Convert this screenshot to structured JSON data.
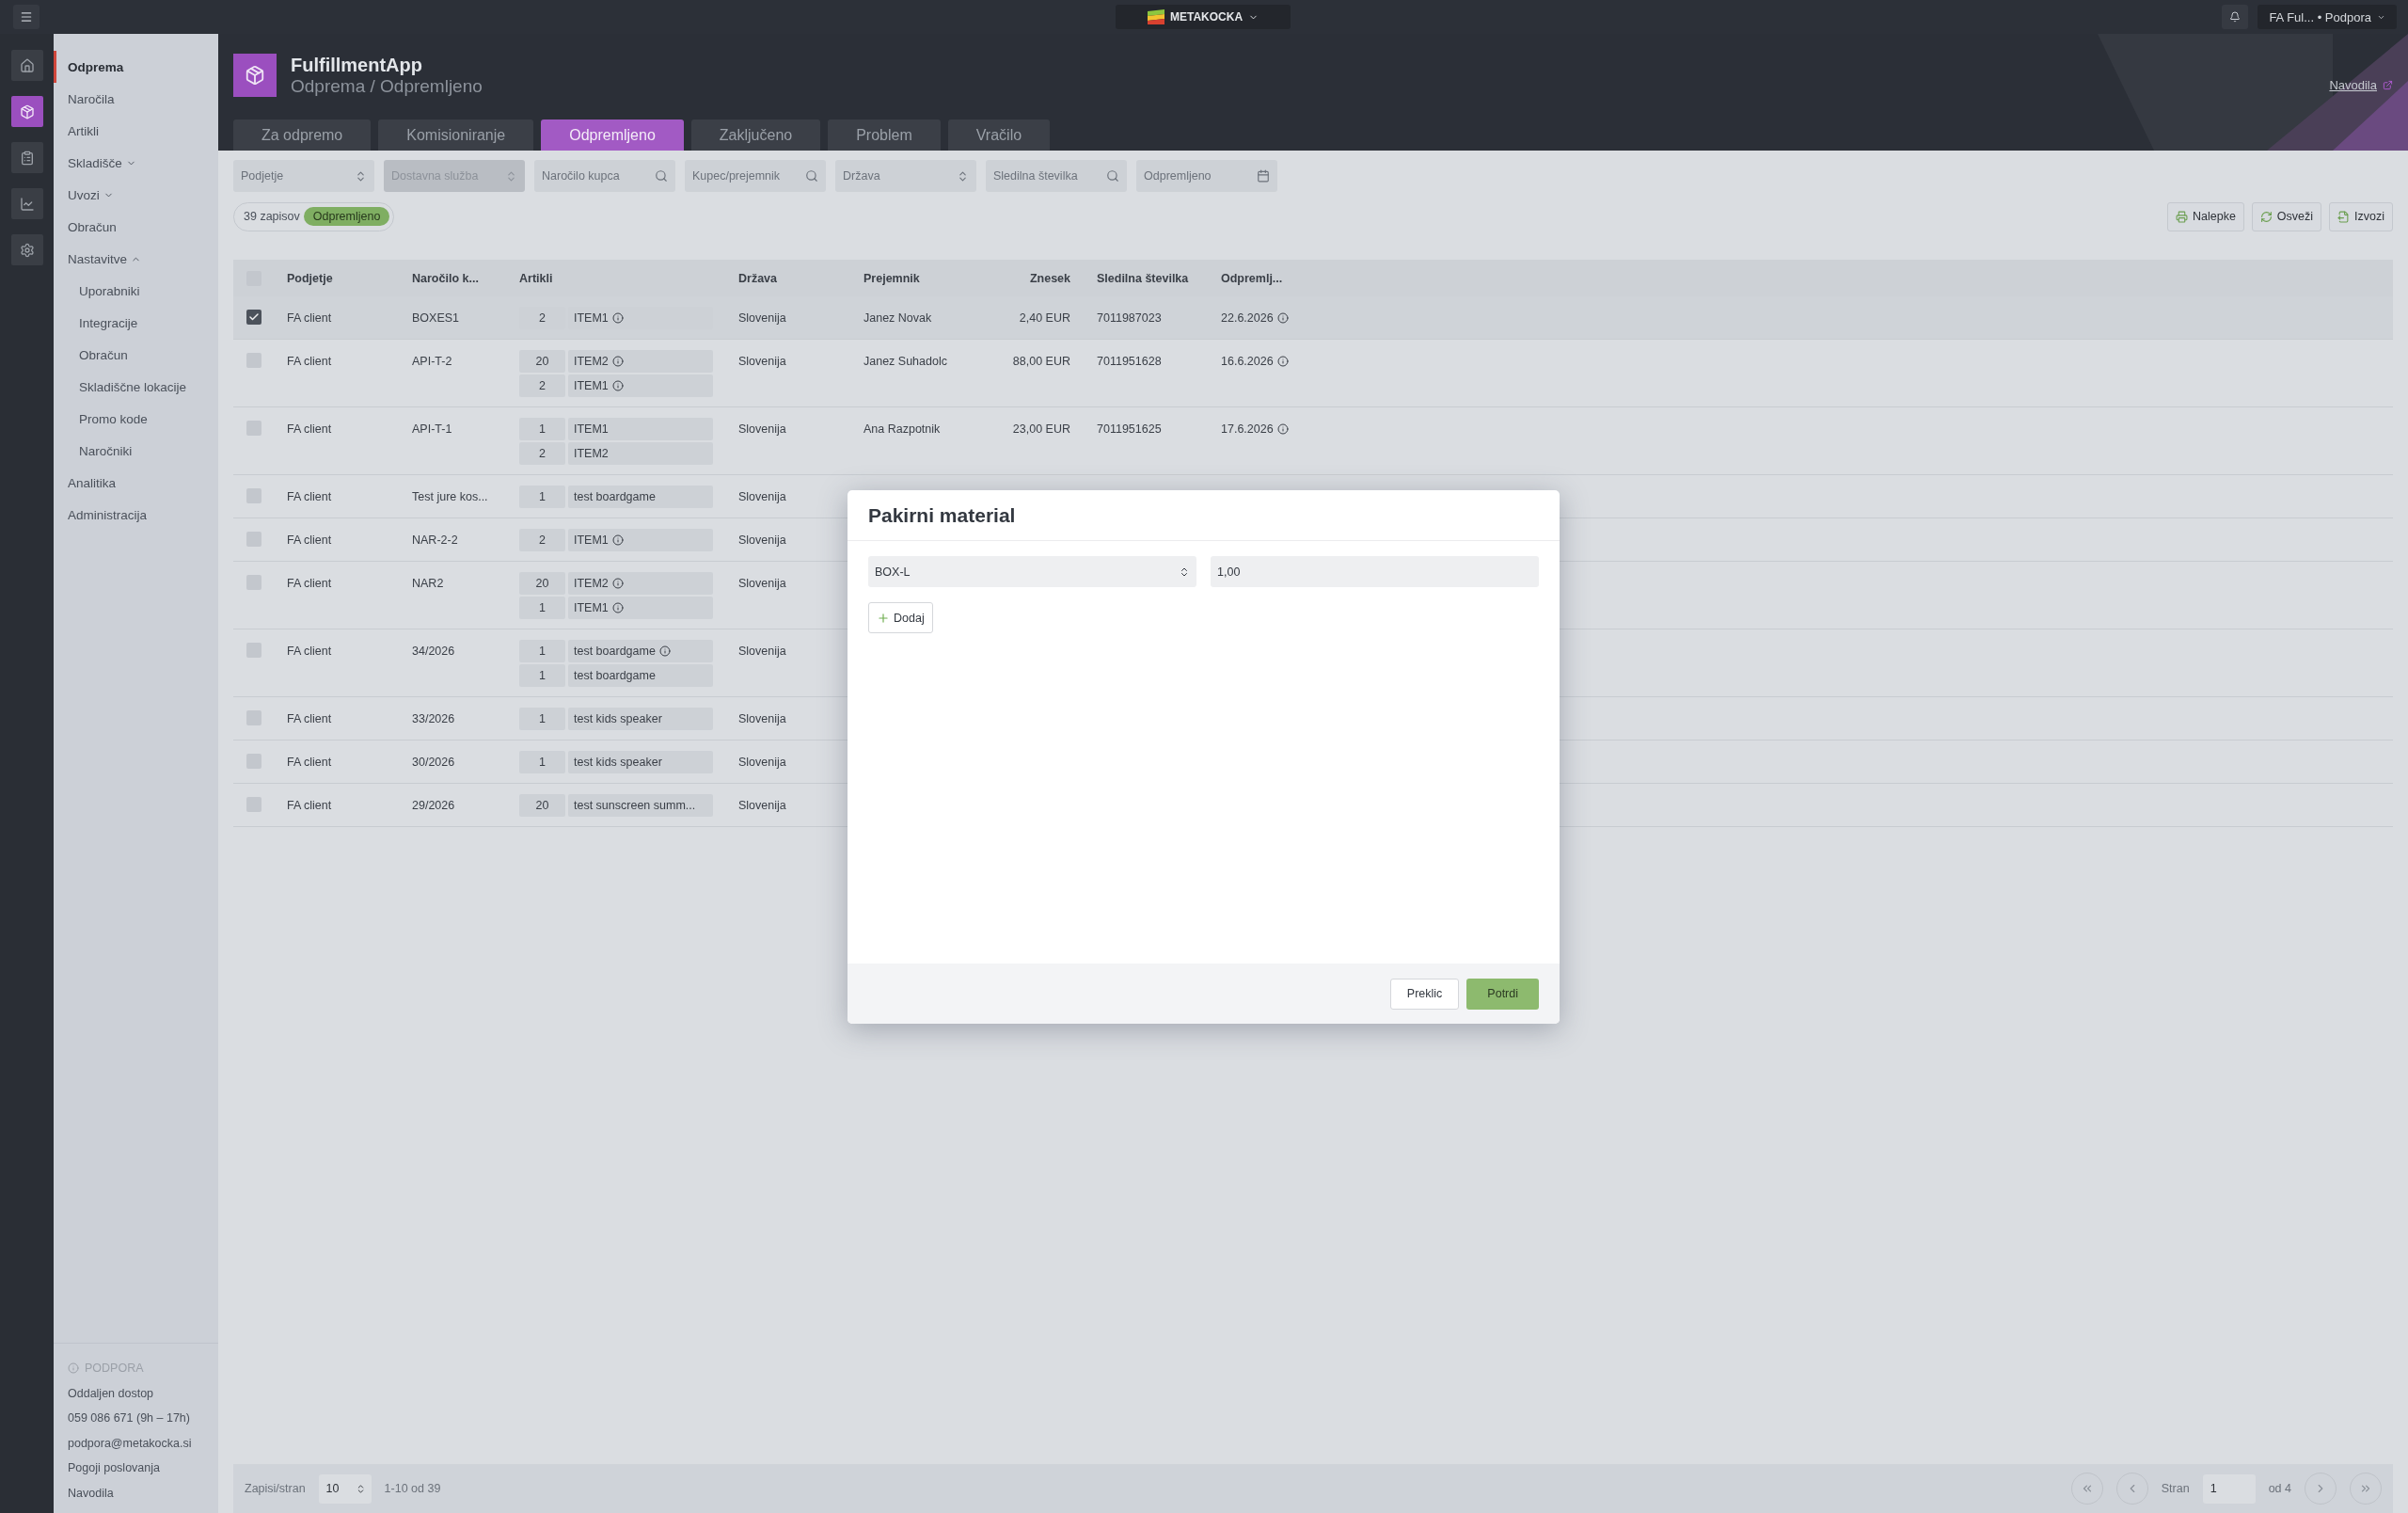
{
  "top_bar": {
    "brand": "METAKOCKA",
    "account": "FA Ful... • Podpora"
  },
  "rail": [
    {
      "kind": "home",
      "selected": false
    },
    {
      "kind": "package",
      "selected": true
    },
    {
      "kind": "report",
      "selected": false
    },
    {
      "kind": "chart",
      "selected": false
    },
    {
      "kind": "settings",
      "selected": false
    }
  ],
  "sidebar": {
    "items": [
      {
        "label": "Odprema",
        "selected": true
      },
      {
        "label": "Naročila",
        "selected": false
      },
      {
        "label": "Artikli",
        "selected": false
      },
      {
        "label": "Skladišče",
        "selected": false,
        "expanded": false
      },
      {
        "label": "Uvozi",
        "selected": false,
        "expanded": false
      },
      {
        "label": "Obračun",
        "selected": false
      },
      {
        "label": "Nastavitve",
        "selected": false,
        "expanded": true,
        "children": [
          {
            "label": "Uporabniki",
            "selected": false
          },
          {
            "label": "Integracije",
            "selected": false
          },
          {
            "label": "Obračun",
            "selected": false
          },
          {
            "label": "Skladiščne lokacije",
            "selected": false
          },
          {
            "label": "Promo kode",
            "selected": false
          },
          {
            "label": "Naročniki",
            "selected": false
          }
        ]
      },
      {
        "label": "Analitika",
        "selected": false
      },
      {
        "label": "Administracija",
        "selected": false
      }
    ],
    "support": {
      "title": "PODPORA",
      "links": [
        "Oddaljen dostop",
        "059 086 671 (9h – 17h)",
        "podpora@metakocka.si",
        "Pogoji poslovanja",
        "Navodila"
      ]
    }
  },
  "header": {
    "app": "FulfillmentApp",
    "breadcrumb": "Odprema / Odpremljeno",
    "help_link": "Navodila"
  },
  "tabs": [
    {
      "label": "Za odpremo",
      "selected": false
    },
    {
      "label": "Komisioniranje",
      "selected": false
    },
    {
      "label": "Odpremljeno",
      "selected": true
    },
    {
      "label": "Zaključeno",
      "selected": false
    },
    {
      "label": "Problem",
      "selected": false
    },
    {
      "label": "Vračilo",
      "selected": false
    }
  ],
  "filters": [
    {
      "kind": "select",
      "placeholder": "Podjetje",
      "disabled": false
    },
    {
      "kind": "select",
      "placeholder": "Dostavna služba",
      "disabled": true
    },
    {
      "kind": "search",
      "placeholder": "Naročilo kupca",
      "disabled": false
    },
    {
      "kind": "search",
      "placeholder": "Kupec/prejemnik",
      "disabled": false
    },
    {
      "kind": "select",
      "placeholder": "Država",
      "disabled": false
    },
    {
      "kind": "search",
      "placeholder": "Sledilna številka",
      "disabled": false
    },
    {
      "kind": "date",
      "placeholder": "Odpremljeno",
      "disabled": false
    }
  ],
  "summary": {
    "count": "39 zapisov",
    "status": "Odpremljeno"
  },
  "actions": [
    {
      "kind": "print",
      "label": "Nalepke"
    },
    {
      "kind": "refresh",
      "label": "Osveži"
    },
    {
      "kind": "export",
      "label": "Izvozi"
    }
  ],
  "table": {
    "all_selected": false,
    "columns": [
      "Podjetje",
      "Naročilo k...",
      "Artikli",
      "Država",
      "Prejemnik",
      "Znesek",
      "Sledilna številka",
      "Odpremlj..."
    ],
    "rows": [
      {
        "selected": true,
        "company": "FA client",
        "order": "BOXES1",
        "items": [
          {
            "qty": "2",
            "name": "ITEM1",
            "info": true
          }
        ],
        "country": "Slovenija",
        "recipient": "Janez Novak",
        "amount": "2,40 EUR",
        "tracking": "7011987023",
        "shipped": "22.6.2026",
        "shipped_info": true
      },
      {
        "selected": false,
        "company": "FA client",
        "order": "API-T-2",
        "items": [
          {
            "qty": "20",
            "name": "ITEM2",
            "info": true
          },
          {
            "qty": "2",
            "name": "ITEM1",
            "info": true
          }
        ],
        "country": "Slovenija",
        "recipient": "Janez Suhadolc",
        "amount": "88,00 EUR",
        "tracking": "7011951628",
        "shipped": "16.6.2026",
        "shipped_info": true
      },
      {
        "selected": false,
        "company": "FA client",
        "order": "API-T-1",
        "items": [
          {
            "qty": "1",
            "name": "ITEM1",
            "info": false
          },
          {
            "qty": "2",
            "name": "ITEM2",
            "info": false
          }
        ],
        "country": "Slovenija",
        "recipient": "Ana Razpotnik",
        "amount": "23,00 EUR",
        "tracking": "7011951625",
        "shipped": "17.6.2026",
        "shipped_info": true
      },
      {
        "selected": false,
        "company": "FA client",
        "order": "Test jure kos...",
        "items": [
          {
            "qty": "1",
            "name": "test boardgame",
            "info": false
          }
        ],
        "country": "Slovenija"
      },
      {
        "selected": false,
        "company": "FA client",
        "order": "NAR-2-2",
        "items": [
          {
            "qty": "2",
            "name": "ITEM1",
            "info": true
          }
        ],
        "country": "Slovenija"
      },
      {
        "selected": false,
        "company": "FA client",
        "order": "NAR2",
        "items": [
          {
            "qty": "20",
            "name": "ITEM2",
            "info": true
          },
          {
            "qty": "1",
            "name": "ITEM1",
            "info": true
          }
        ],
        "country": "Slovenija"
      },
      {
        "selected": false,
        "company": "FA client",
        "order": "34/2026",
        "items": [
          {
            "qty": "1",
            "name": "test boardgame",
            "info": true
          },
          {
            "qty": "1",
            "name": "test boardgame",
            "info": false
          }
        ],
        "country": "Slovenija"
      },
      {
        "selected": false,
        "company": "FA client",
        "order": "33/2026",
        "items": [
          {
            "qty": "1",
            "name": "test kids speaker",
            "info": false
          }
        ],
        "country": "Slovenija"
      },
      {
        "selected": false,
        "company": "FA client",
        "order": "30/2026",
        "items": [
          {
            "qty": "1",
            "name": "test kids speaker",
            "info": false
          }
        ],
        "country": "Slovenija"
      },
      {
        "selected": false,
        "company": "FA client",
        "order": "29/2026",
        "items": [
          {
            "qty": "20",
            "name": "test sunscreen summ...",
            "info": false
          }
        ],
        "country": "Slovenija"
      }
    ]
  },
  "pagination": {
    "page_size_label": "Zapisi/stran",
    "page_size": "10",
    "range": "1-10 od 39",
    "page_label": "Stran",
    "page": "1",
    "total": "od 4"
  },
  "modal": {
    "title": "Pakirni material",
    "material": "BOX-L",
    "quantity": "1,00",
    "add": "Dodaj",
    "cancel": "Preklic",
    "confirm": "Potrdi"
  }
}
